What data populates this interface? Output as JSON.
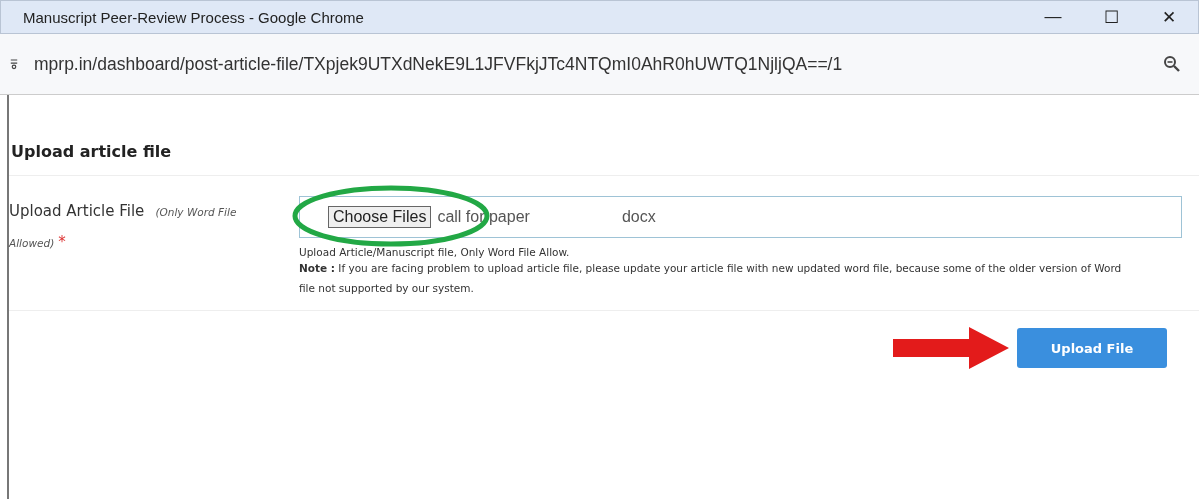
{
  "window": {
    "title": "Manuscript Peer-Review Process - Google Chrome",
    "controls": [
      "—",
      "☐",
      "✕"
    ]
  },
  "address_bar": {
    "url": "mprp.in/dashboard/post-article-file/TXpjek9UTXdNekE9L1JFVFkjJTc4NTQmI0AhR0hUWTQ1NjljQA==/1"
  },
  "page": {
    "heading": "Upload article file",
    "form": {
      "label": "Upload Article File",
      "label_note": "(Only Word File Allowed)",
      "required_mark": "*",
      "required": true,
      "file_input": {
        "button": "Choose Files",
        "file_name": "call for paper",
        "file_ext": "docx"
      },
      "hint": "Upload Article/Manuscript file, Only Word File Allow.",
      "note": "**Note :** If you are facing problem to upload article file, please update your article file with new updated word file, because some of the older version of Word file not supported by our system."
    },
    "submit_button": "Upload File"
  }
}
